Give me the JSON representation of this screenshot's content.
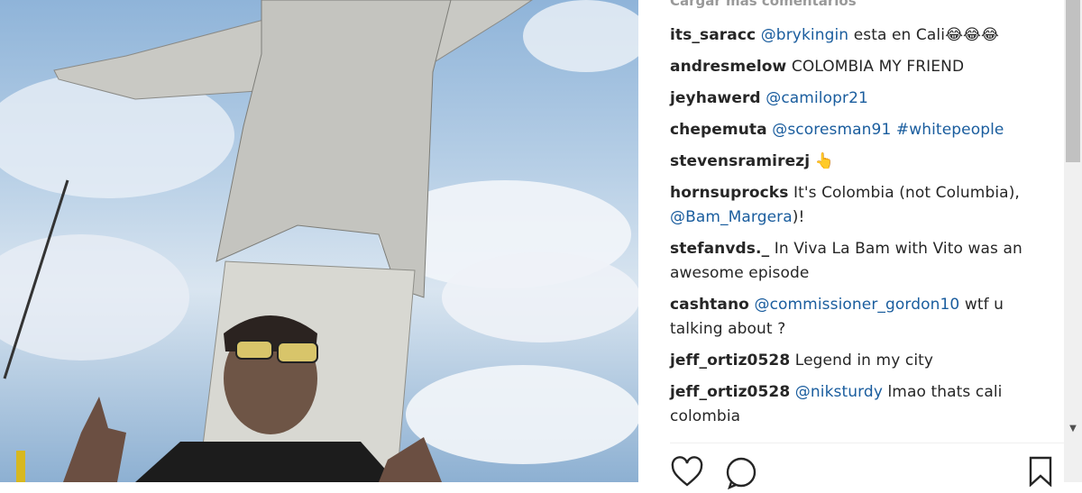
{
  "comments_header": {
    "load_more": "Cargar más comentarios"
  },
  "comments": [
    {
      "user": "its_saracc",
      "parts": [
        {
          "type": "mention",
          "text": "@brykingin"
        },
        {
          "type": "text",
          "text": " esta en Cali😂😂😂"
        }
      ]
    },
    {
      "user": "andresmelow",
      "parts": [
        {
          "type": "text",
          "text": "COLOMBIA MY FRIEND"
        }
      ]
    },
    {
      "user": "jeyhawerd",
      "parts": [
        {
          "type": "mention",
          "text": "@camilopr21"
        }
      ]
    },
    {
      "user": "chepemuta",
      "parts": [
        {
          "type": "mention",
          "text": "@scoresman91"
        },
        {
          "type": "text",
          "text": " "
        },
        {
          "type": "mention",
          "text": "#whitepeople"
        }
      ]
    },
    {
      "user": "stevensramirezj",
      "parts": [
        {
          "type": "text",
          "text": "👆"
        }
      ]
    },
    {
      "user": "hornsuprocks",
      "parts": [
        {
          "type": "text",
          "text": "It's Colombia (not Columbia), "
        },
        {
          "type": "mention",
          "text": "@Bam_Margera"
        },
        {
          "type": "text",
          "text": ")!"
        }
      ]
    },
    {
      "user": "stefanvds._",
      "parts": [
        {
          "type": "text",
          "text": "In Viva La Bam with Vito was an awesome episode"
        }
      ]
    },
    {
      "user": "cashtano",
      "parts": [
        {
          "type": "mention",
          "text": "@commissioner_gordon10"
        },
        {
          "type": "text",
          "text": " wtf u talking about ?"
        }
      ]
    },
    {
      "user": "jeff_ortiz0528",
      "parts": [
        {
          "type": "text",
          "text": "Legend in my city"
        }
      ]
    },
    {
      "user": "jeff_ortiz0528",
      "parts": [
        {
          "type": "mention",
          "text": "@niksturdy"
        },
        {
          "type": "text",
          "text": " lmao thats cali colombia"
        }
      ]
    }
  ],
  "actions": {
    "like_icon": "heart-icon",
    "comment_icon": "comment-icon",
    "save_icon": "bookmark-icon"
  }
}
